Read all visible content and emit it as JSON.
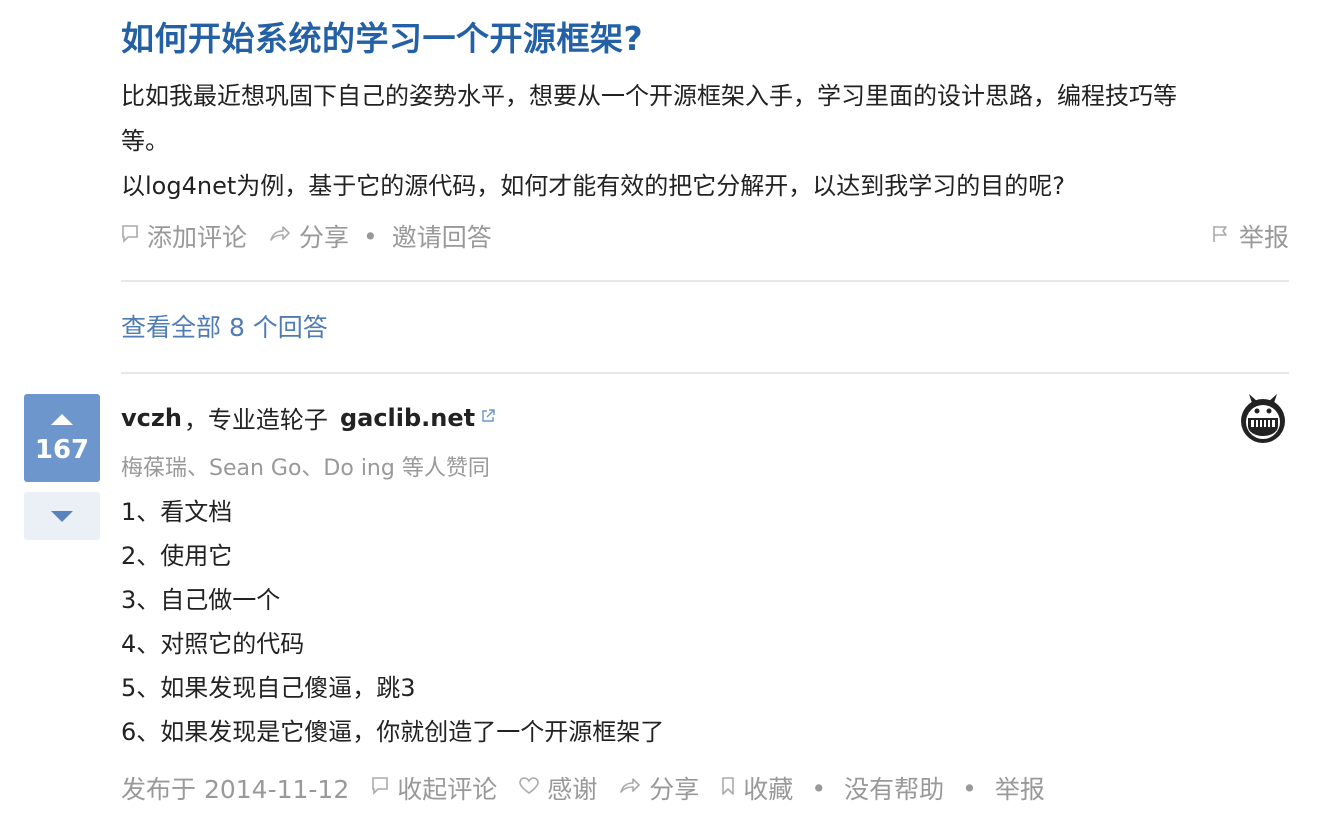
{
  "question": {
    "title": "如何开始系统的学习一个开源框架?",
    "body": [
      "比如我最近想巩固下自己的姿势水平，想要从一个开源框架入手，学习里面的设计思路，编程技巧等",
      "等。",
      "以log4net为例，基于它的源代码，如何才能有效的把它分解开，以达到我学习的目的呢?"
    ],
    "actions": {
      "add_comment": "添加评论",
      "share": "分享",
      "separator": "•",
      "invite": "邀请回答",
      "report": "举报"
    }
  },
  "all_answers": "查看全部 8 个回答",
  "answer": {
    "votes": "167",
    "author_name": "vczh",
    "author_bio": "，专业造轮子",
    "author_link": "gaclib.net",
    "voters": "梅葆瑞、Sean Go、Do ing 等人赞同",
    "lines": [
      "1、看文档",
      "2、使用它",
      "3、自己做一个",
      "4、对照它的代码",
      "5、如果发现自己傻逼，跳3",
      "6、如果发现是它傻逼，你就创造了一个开源框架了"
    ],
    "actions": {
      "date": "发布于 2014-11-12",
      "collapse_comments": "收起评论",
      "thanks": "感谢",
      "share": "分享",
      "favorite": "收藏",
      "separator": "•",
      "not_helpful": "没有帮助",
      "report": "举报"
    }
  },
  "icons": {
    "comment": "comment-icon",
    "share": "share-icon",
    "flag": "flag-icon",
    "heart": "heart-icon",
    "bookmark": "bookmark-icon",
    "external_link": "external-link-icon",
    "vote_up": "triangle-up-icon",
    "vote_down": "triangle-down-icon"
  },
  "colors": {
    "title": "#2360a5",
    "link": "#4f7cb5",
    "vote_bg": "#6d96cc",
    "vote_down_bg": "#eaf0f6",
    "muted": "#999999"
  }
}
